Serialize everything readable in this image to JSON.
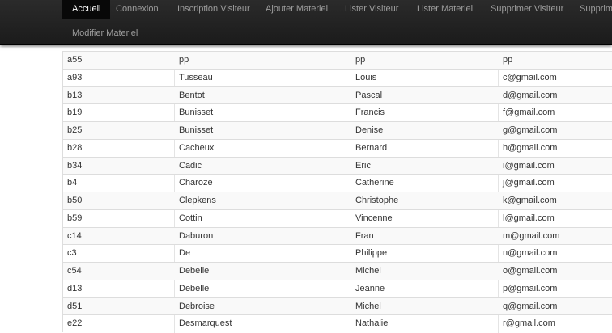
{
  "navbar": {
    "items": [
      {
        "label": "Accueil",
        "active": true
      },
      {
        "label": "Connexion"
      },
      {
        "label": "Inscription Visiteur"
      },
      {
        "label": "Ajouter Materiel"
      },
      {
        "label": "Lister Visiteur"
      },
      {
        "label": "Lister Materiel"
      },
      {
        "label": "Supprimer Visiteur"
      },
      {
        "label": "Supprime"
      },
      {
        "label": "Modifier Materiel"
      }
    ]
  },
  "table": {
    "rows": [
      [
        "a55",
        "pp",
        "pp",
        "pp"
      ],
      [
        "a93",
        "Tusseau",
        "Louis",
        "c@gmail.com"
      ],
      [
        "b13",
        "Bentot",
        "Pascal",
        "d@gmail.com"
      ],
      [
        "b19",
        "Bunisset",
        "Francis",
        "f@gmail.com"
      ],
      [
        "b25",
        "Bunisset",
        "Denise",
        "g@gmail.com"
      ],
      [
        "b28",
        "Cacheux",
        "Bernard",
        "h@gmail.com"
      ],
      [
        "b34",
        "Cadic",
        "Eric",
        "i@gmail.com"
      ],
      [
        "b4",
        "Charoze",
        "Catherine",
        "j@gmail.com"
      ],
      [
        "b50",
        "Clepkens",
        "Christophe",
        "k@gmail.com"
      ],
      [
        "b59",
        "Cottin",
        "Vincenne",
        "l@gmail.com"
      ],
      [
        "c14",
        "Daburon",
        "Fran",
        "m@gmail.com"
      ],
      [
        "c3",
        "De",
        "Philippe",
        "n@gmail.com"
      ],
      [
        "c54",
        "Debelle",
        "Michel",
        "o@gmail.com"
      ],
      [
        "d13",
        "Debelle",
        "Jeanne",
        "p@gmail.com"
      ],
      [
        "d51",
        "Debroise",
        "Michel",
        "q@gmail.com"
      ],
      [
        "e22",
        "Desmarquest",
        "Nathalie",
        "r@gmail.com"
      ]
    ]
  }
}
